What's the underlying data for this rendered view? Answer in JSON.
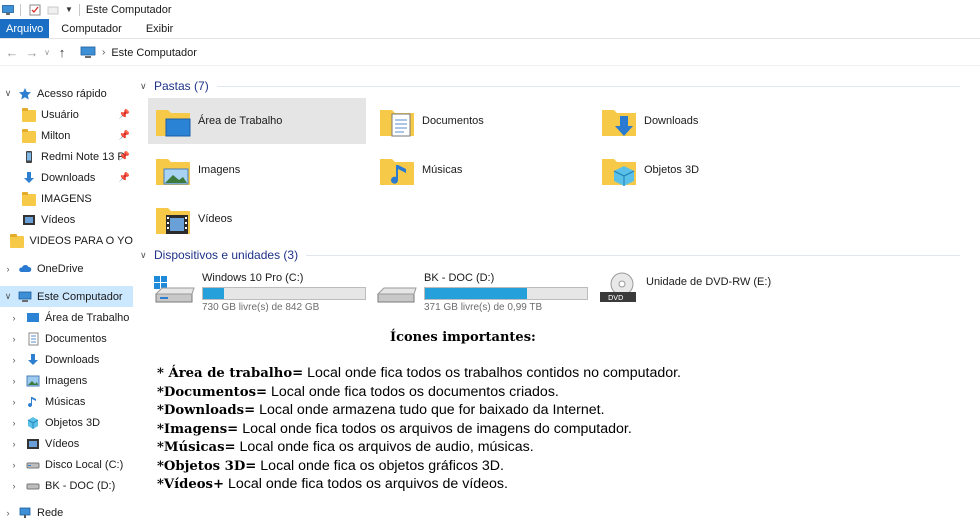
{
  "window": {
    "title": "Este Computador"
  },
  "ribbon": {
    "tabs": [
      "Arquivo",
      "Computador",
      "Exibir"
    ]
  },
  "address": {
    "path": [
      "Este Computador"
    ]
  },
  "sidebar": {
    "items": [
      {
        "label": "Acesso rápido",
        "icon": "star-icon",
        "level": 0,
        "chevron": "open"
      },
      {
        "label": "Usuário",
        "icon": "folder-icon",
        "level": 1,
        "pinned": true
      },
      {
        "label": "Milton",
        "icon": "folder-icon",
        "level": 1,
        "pinned": true
      },
      {
        "label": "Redmi Note 13 P",
        "icon": "phone-icon",
        "level": 1,
        "pinned": true
      },
      {
        "label": "Downloads",
        "icon": "download-icon",
        "level": 1,
        "pinned": true
      },
      {
        "label": "IMAGENS",
        "icon": "folder-icon",
        "level": 1
      },
      {
        "label": "Vídeos",
        "icon": "video-icon",
        "level": 1
      },
      {
        "label": "VIDEOS PARA O YO",
        "icon": "folder-icon",
        "level": 1
      },
      {
        "label": "OneDrive",
        "icon": "cloud-icon",
        "level": 0,
        "chevron": "closed"
      },
      {
        "label": "Este Computador",
        "icon": "computer-icon",
        "level": 0,
        "chevron": "open",
        "selected": true
      },
      {
        "label": "Área de Trabalho",
        "icon": "desktop-icon",
        "level": 1,
        "chevron": "closed"
      },
      {
        "label": "Documentos",
        "icon": "documents-icon",
        "level": 1,
        "chevron": "closed"
      },
      {
        "label": "Downloads",
        "icon": "download-icon",
        "level": 1,
        "chevron": "closed"
      },
      {
        "label": "Imagens",
        "icon": "pictures-icon",
        "level": 1,
        "chevron": "closed"
      },
      {
        "label": "Músicas",
        "icon": "music-icon",
        "level": 1,
        "chevron": "closed"
      },
      {
        "label": "Objetos 3D",
        "icon": "cube-icon",
        "level": 1,
        "chevron": "closed"
      },
      {
        "label": "Vídeos",
        "icon": "video-icon",
        "level": 1,
        "chevron": "closed"
      },
      {
        "label": "Disco Local (C:)",
        "icon": "drive-icon",
        "level": 1,
        "chevron": "closed"
      },
      {
        "label": "BK - DOC (D:)",
        "icon": "drive-icon",
        "level": 1,
        "chevron": "closed"
      },
      {
        "label": "Rede",
        "icon": "network-icon",
        "level": 0,
        "chevron": "closed"
      }
    ]
  },
  "folders": {
    "heading": "Pastas (7)",
    "items": [
      {
        "label": "Área de Trabalho",
        "icon": "desktop-folder-icon",
        "selected": true
      },
      {
        "label": "Documentos",
        "icon": "documents-folder-icon"
      },
      {
        "label": "Downloads",
        "icon": "downloads-folder-icon"
      },
      {
        "label": "Imagens",
        "icon": "pictures-folder-icon"
      },
      {
        "label": "Músicas",
        "icon": "music-folder-icon"
      },
      {
        "label": "Objetos 3D",
        "icon": "objects3d-folder-icon"
      },
      {
        "label": "Vídeos",
        "icon": "videos-folder-icon"
      }
    ]
  },
  "drives": {
    "heading": "Dispositivos e unidades (3)",
    "items": [
      {
        "label": "Windows 10 Pro (C:)",
        "free": "730 GB livre(s) de 842 GB",
        "used_fraction": 0.13,
        "icon": "windows-drive-icon"
      },
      {
        "label": "BK - DOC (D:)",
        "free": "371 GB livre(s) de 0,99 TB",
        "used_fraction": 0.63,
        "icon": "drive-icon"
      },
      {
        "label": "Unidade de DVD-RW (E:)",
        "icon": "dvd-drive-icon"
      }
    ]
  },
  "notes": {
    "title": "Ícones importantes:",
    "items": [
      {
        "term": "* Área de trabalho=",
        "desc": " Local onde fica todos os trabalhos contidos no computador."
      },
      {
        "term": "*Documentos=",
        "desc": " Local onde fica todos os documentos criados."
      },
      {
        "term": "*Downloads=",
        "desc": " Local onde armazena tudo que for baixado da Internet."
      },
      {
        "term": "*Imagens=",
        "desc": " Local onde fica todos os arquivos de imagens do computador."
      },
      {
        "term": "*Músicas=",
        "desc": " Local onde fica os arquivos de audio, músicas."
      },
      {
        "term": "*Objetos 3D=",
        "desc": " Local onde fica os objetos gráficos 3D."
      },
      {
        "term": "*Vídeos+",
        "desc": " Local onde fica todos os arquivos de vídeos."
      }
    ]
  },
  "colors": {
    "accent": "#1a6fc4",
    "selection": "#cce8ff",
    "folder": "#f7c948",
    "group_heading": "#1e3287",
    "drive_fill": "#26a0da"
  }
}
